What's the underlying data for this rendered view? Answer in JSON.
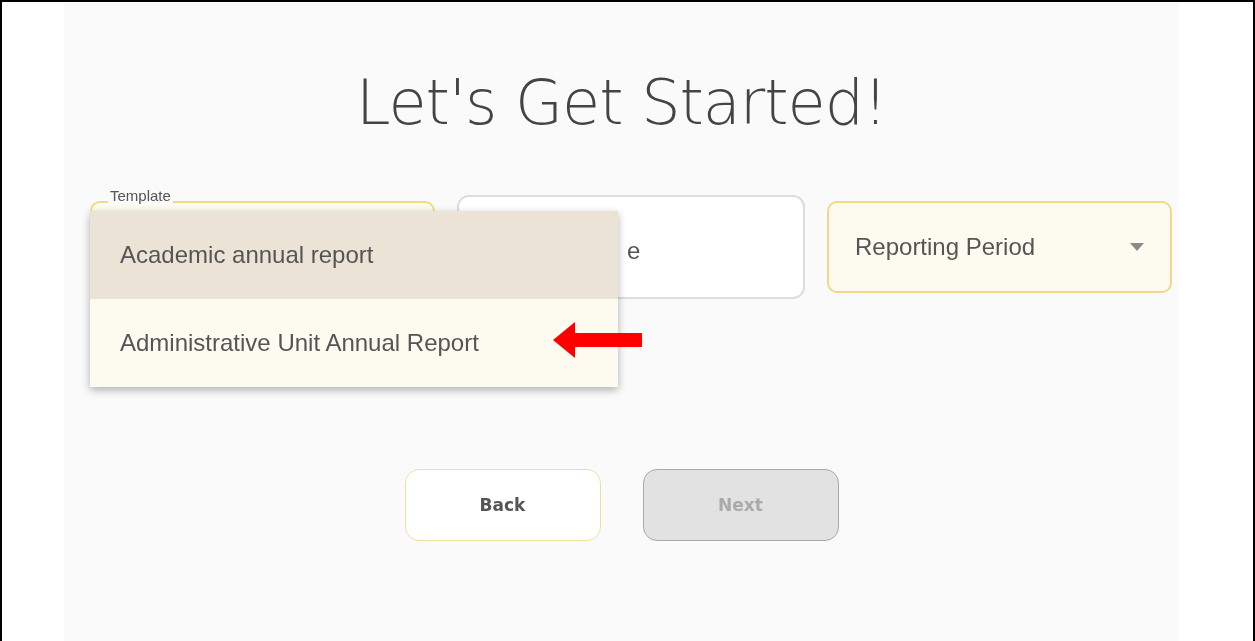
{
  "title": "Let's Get Started!",
  "fields": [
    {
      "kind": "select",
      "label": "Template",
      "expanded": true,
      "options": [
        {
          "label": "Academic annual report",
          "selected": true
        },
        {
          "label": "Administrative Unit Annual Report",
          "selected": false
        }
      ]
    },
    {
      "kind": "text",
      "value": "e"
    },
    {
      "kind": "select",
      "placeholder": "Reporting Period",
      "expanded": false
    }
  ],
  "annotation": {
    "kind": "arrow"
  },
  "buttons": [
    {
      "label": "Back",
      "disabled": false
    },
    {
      "label": "Next",
      "disabled": true
    }
  ]
}
